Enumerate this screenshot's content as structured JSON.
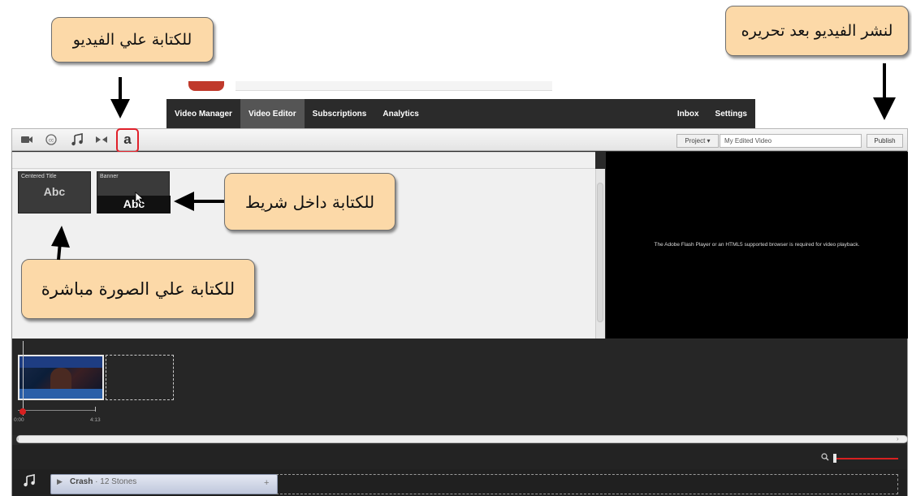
{
  "nav": {
    "items": [
      {
        "label": "Video Manager",
        "active": false
      },
      {
        "label": "Video Editor",
        "active": true
      },
      {
        "label": "Subscriptions",
        "active": false
      },
      {
        "label": "Analytics",
        "active": false
      }
    ],
    "right_items": [
      {
        "label": "Inbox"
      },
      {
        "label": "Settings"
      }
    ]
  },
  "toolbar": {
    "tools": [
      {
        "icon": "video-camera-icon"
      },
      {
        "icon": "cc-icon"
      },
      {
        "icon": "music-note-icon"
      },
      {
        "icon": "transition-icon"
      },
      {
        "icon": "text-icon",
        "label": "a",
        "highlighted": true
      }
    ],
    "project_label": "Project ▾",
    "project_name": "My Edited Video",
    "publish_label": "Publish"
  },
  "library": {
    "tiles": [
      {
        "label": "Centered Title",
        "sample": "Abc"
      },
      {
        "label": "Banner",
        "sample": "Abc"
      }
    ]
  },
  "player": {
    "message": "The Adobe Flash Player or an HTML5 supported browser is required for video playback."
  },
  "timeline": {
    "clip_title": "...",
    "time_start": "0:00",
    "time_end": "4:13"
  },
  "audio": {
    "track": "Crash",
    "separator": "·",
    "artist": "12 Stones",
    "add": "+"
  },
  "callouts": {
    "write_on_video": "للكتابة علي الفيديو",
    "publish_after_edit": "لنشر الفيديو بعد تحريره",
    "write_in_banner": "للكتابة داخل شريط",
    "write_on_image": "للكتابة علي الصورة مباشرة"
  },
  "colors": {
    "callout_bg": "#fcd9a8",
    "highlight_red": "#e0202a",
    "nav_bg": "#2b2b2b",
    "timeline_bg": "#262626"
  }
}
